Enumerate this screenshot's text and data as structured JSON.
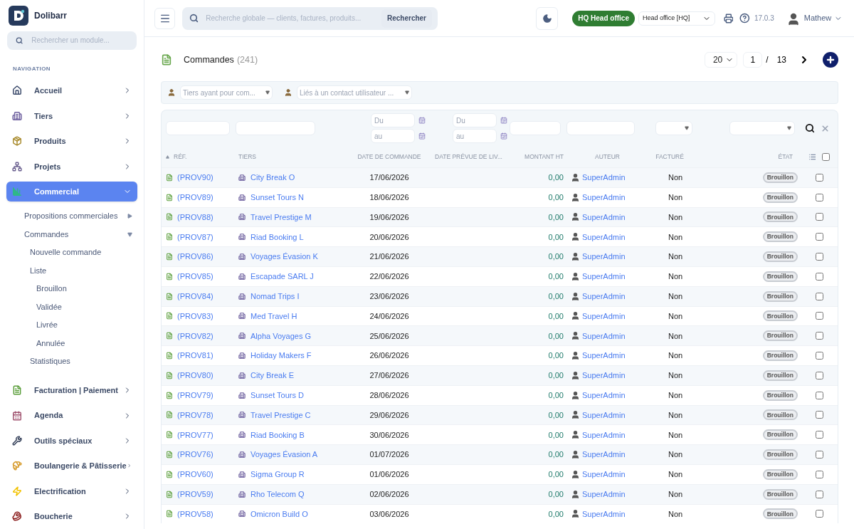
{
  "app": {
    "name": "Dolibarr",
    "module_search_placeholder": "Rechercher un module...",
    "nav_heading": "NAVIGATION"
  },
  "nav": [
    {
      "label": "Accueil",
      "kind": "home",
      "selected": false,
      "expanded": false
    },
    {
      "label": "Tiers",
      "kind": "building",
      "selected": false,
      "expanded": false
    },
    {
      "label": "Produits",
      "kind": "box",
      "selected": false,
      "expanded": false
    },
    {
      "label": "Projets",
      "kind": "projects",
      "selected": false,
      "expanded": false
    },
    {
      "label": "Commercial",
      "kind": "commercial",
      "selected": true,
      "expanded": true,
      "children": [
        {
          "label": "Propositions commerciales",
          "expanded": false
        },
        {
          "label": "Commandes",
          "expanded": true,
          "children": [
            {
              "label": "Nouvelle commande"
            },
            {
              "label": "Liste",
              "children": [
                {
                  "label": "Brouillon"
                },
                {
                  "label": "Validée"
                },
                {
                  "label": "Livrée"
                },
                {
                  "label": "Annulée"
                }
              ]
            },
            {
              "label": "Statistiques"
            }
          ]
        }
      ]
    },
    {
      "label": "Facturation | Paiement",
      "kind": "invoice",
      "selected": false,
      "expanded": false
    },
    {
      "label": "Agenda",
      "kind": "calendar",
      "selected": false,
      "expanded": false
    },
    {
      "label": "Outils spéciaux",
      "kind": "tools",
      "selected": false,
      "expanded": false
    },
    {
      "label": "Boulangerie & Pâtisserie",
      "kind": "bread",
      "selected": false,
      "expanded": false
    },
    {
      "label": "Electrification",
      "kind": "bolt",
      "selected": false,
      "expanded": false
    },
    {
      "label": "Boucherie",
      "kind": "meat",
      "selected": false,
      "expanded": false
    }
  ],
  "topbar": {
    "search_placeholder": "Recherche globale — clients, factures, produits...",
    "search_button": "Rechercher",
    "entity_badge": "HQ Head office",
    "entity_select": "Head office [HQ]",
    "version": "17.0.3",
    "user": "Mathew"
  },
  "page": {
    "title": "Commandes",
    "count": "(241)",
    "per_page": "20",
    "page": "1",
    "page_sep": "/",
    "pages": "13"
  },
  "filters": {
    "thirdparty_placeholder": "Tiers ayant pour com...",
    "contact_placeholder": "Liés à un contact utilisateur ...",
    "date_ranges": [
      {
        "from_placeholder": "Du",
        "to_placeholder": "au"
      },
      {
        "from_placeholder": "Du",
        "to_placeholder": "au"
      }
    ]
  },
  "table": {
    "select_all_checked": false,
    "columns": [
      "RÉF.",
      "TIERS",
      "DATE DE COMMANDE",
      "DATE PRÉVUE DE LIV...",
      "MONTANT HT",
      "AUTEUR",
      "FACTURÉ",
      "ÉTAT"
    ],
    "rows": [
      {
        "ref": "(PROV90)",
        "tiers": "City Break O",
        "date": "17/06/2026",
        "amount": "0,00",
        "author": "SuperAdmin",
        "billed": "Non",
        "status": "Brouillon",
        "checked": false
      },
      {
        "ref": "(PROV89)",
        "tiers": "Sunset Tours N",
        "date": "18/06/2026",
        "amount": "0,00",
        "author": "SuperAdmin",
        "billed": "Non",
        "status": "Brouillon",
        "checked": false
      },
      {
        "ref": "(PROV88)",
        "tiers": "Travel Prestige M",
        "date": "19/06/2026",
        "amount": "0,00",
        "author": "SuperAdmin",
        "billed": "Non",
        "status": "Brouillon",
        "checked": false
      },
      {
        "ref": "(PROV87)",
        "tiers": "Riad Booking L",
        "date": "20/06/2026",
        "amount": "0,00",
        "author": "SuperAdmin",
        "billed": "Non",
        "status": "Brouillon",
        "checked": false
      },
      {
        "ref": "(PROV86)",
        "tiers": "Voyages Évasion K",
        "date": "21/06/2026",
        "amount": "0,00",
        "author": "SuperAdmin",
        "billed": "Non",
        "status": "Brouillon",
        "checked": false
      },
      {
        "ref": "(PROV85)",
        "tiers": "Escapade SARL J",
        "date": "22/06/2026",
        "amount": "0,00",
        "author": "SuperAdmin",
        "billed": "Non",
        "status": "Brouillon",
        "checked": false
      },
      {
        "ref": "(PROV84)",
        "tiers": "Nomad Trips I",
        "date": "23/06/2026",
        "amount": "0,00",
        "author": "SuperAdmin",
        "billed": "Non",
        "status": "Brouillon",
        "checked": false
      },
      {
        "ref": "(PROV83)",
        "tiers": "Med Travel H",
        "date": "24/06/2026",
        "amount": "0,00",
        "author": "SuperAdmin",
        "billed": "Non",
        "status": "Brouillon",
        "checked": false
      },
      {
        "ref": "(PROV82)",
        "tiers": "Alpha Voyages G",
        "date": "25/06/2026",
        "amount": "0,00",
        "author": "SuperAdmin",
        "billed": "Non",
        "status": "Brouillon",
        "checked": false
      },
      {
        "ref": "(PROV81)",
        "tiers": "Holiday Makers F",
        "date": "26/06/2026",
        "amount": "0,00",
        "author": "SuperAdmin",
        "billed": "Non",
        "status": "Brouillon",
        "checked": false
      },
      {
        "ref": "(PROV80)",
        "tiers": "City Break E",
        "date": "27/06/2026",
        "amount": "0,00",
        "author": "SuperAdmin",
        "billed": "Non",
        "status": "Brouillon",
        "checked": false
      },
      {
        "ref": "(PROV79)",
        "tiers": "Sunset Tours D",
        "date": "28/06/2026",
        "amount": "0,00",
        "author": "SuperAdmin",
        "billed": "Non",
        "status": "Brouillon",
        "checked": false
      },
      {
        "ref": "(PROV78)",
        "tiers": "Travel Prestige C",
        "date": "29/06/2026",
        "amount": "0,00",
        "author": "SuperAdmin",
        "billed": "Non",
        "status": "Brouillon",
        "checked": false
      },
      {
        "ref": "(PROV77)",
        "tiers": "Riad Booking B",
        "date": "30/06/2026",
        "amount": "0,00",
        "author": "SuperAdmin",
        "billed": "Non",
        "status": "Brouillon",
        "checked": false
      },
      {
        "ref": "(PROV76)",
        "tiers": "Voyages Évasion A",
        "date": "01/07/2026",
        "amount": "0,00",
        "author": "SuperAdmin",
        "billed": "Non",
        "status": "Brouillon",
        "checked": false
      },
      {
        "ref": "(PROV60)",
        "tiers": "Sigma Group R",
        "date": "01/06/2026",
        "amount": "0,00",
        "author": "SuperAdmin",
        "billed": "Non",
        "status": "Brouillon",
        "checked": false
      },
      {
        "ref": "(PROV59)",
        "tiers": "Rho Telecom Q",
        "date": "02/06/2026",
        "amount": "0,00",
        "author": "SuperAdmin",
        "billed": "Non",
        "status": "Brouillon",
        "checked": false
      },
      {
        "ref": "(PROV58)",
        "tiers": "Omicron Build O",
        "date": "03/06/2026",
        "amount": "0,00",
        "author": "SuperAdmin",
        "billed": "Non",
        "status": "Brouillon",
        "checked": false
      }
    ]
  }
}
